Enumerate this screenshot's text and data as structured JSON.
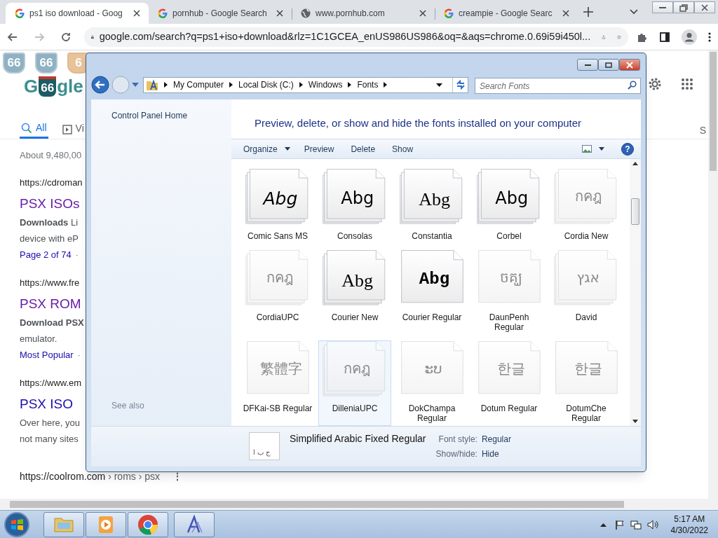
{
  "browser": {
    "tabs": [
      {
        "title": "ps1 iso download - Goog",
        "selected": true
      },
      {
        "title": "pornhub - Google Search",
        "selected": false
      },
      {
        "title": "www.pornhub.com",
        "selected": false
      },
      {
        "title": "creampie - Google Searc",
        "selected": false
      }
    ],
    "address": "google.com/search?q=ps1+iso+download&rlz=1C1GCEA_enUS986US986&oq=&aqs=chrome.0.69i59i450l..."
  },
  "google": {
    "badges": [
      "66",
      "66",
      "6"
    ],
    "logo": [
      "G",
      "66",
      "gle"
    ],
    "search_tabs": [
      {
        "label": "All",
        "selected": true
      },
      {
        "label": "Vi",
        "selected": false
      }
    ],
    "right_tab": "S",
    "result_count": "About 9,480,00",
    "results": [
      {
        "url": "https://cdroman",
        "title": "PSX ISOs",
        "visited": true,
        "snippet": [
          "**Downloads** Li",
          "device with eP"
        ],
        "link": "Page 2 of 74",
        "after": "·"
      },
      {
        "url": "https://www.fre",
        "title": "PSX ROM",
        "visited": true,
        "snippet": [
          "**Download PSX**",
          "emulator."
        ],
        "link": "Most Popular",
        "after": "·"
      },
      {
        "url": "https://www.em",
        "title": "PSX ISO",
        "visited": false,
        "snippet": [
          "Over here, you",
          "not many sites"
        ]
      }
    ],
    "last_url": [
      "https://coolrom.com",
      "› roms › psx"
    ],
    "more": "⋮"
  },
  "explorer": {
    "breadcrumbs": [
      "My Computer",
      "Local Disk (C:)",
      "Windows",
      "Fonts"
    ],
    "search_placeholder": "Search Fonts",
    "sidebar": {
      "top": "Control Panel Home",
      "bottom": "See also"
    },
    "heading": "Preview, delete, or show and hide the fonts installed on your computer",
    "toolbar": [
      {
        "label": "Organize",
        "menu": true
      },
      {
        "label": "Preview",
        "menu": false
      },
      {
        "label": "Delete",
        "menu": false
      },
      {
        "label": "Show",
        "menu": false
      }
    ],
    "help": "?",
    "fonts": [
      {
        "name": "Comic Sans MS",
        "sample": "Abg",
        "stacked": true,
        "hidden": false,
        "selected": false
      },
      {
        "name": "Consolas",
        "sample": "Abg",
        "stacked": true,
        "hidden": false,
        "selected": false
      },
      {
        "name": "Constantia",
        "sample": "Abg",
        "stacked": true,
        "hidden": false,
        "selected": false
      },
      {
        "name": "Corbel",
        "sample": "Abg",
        "stacked": true,
        "hidden": false,
        "selected": false
      },
      {
        "name": "Cordia New",
        "sample": "กคฎ",
        "stacked": true,
        "hidden": true,
        "selected": false
      },
      {
        "name": "CordiaUPC",
        "sample": "กคฎ",
        "stacked": true,
        "hidden": true,
        "selected": false
      },
      {
        "name": "Courier New",
        "sample": "Abg",
        "stacked": true,
        "hidden": false,
        "selected": false
      },
      {
        "name": "Courier Regular",
        "sample": "Abg",
        "stacked": false,
        "hidden": false,
        "selected": false
      },
      {
        "name": "DaunPenh Regular",
        "sample": "ចគ្ឃ",
        "stacked": false,
        "hidden": true,
        "selected": false
      },
      {
        "name": "David",
        "sample": "אגץ",
        "stacked": true,
        "hidden": true,
        "selected": false
      },
      {
        "name": "DFKai-SB Regular",
        "sample": "繁體字",
        "stacked": false,
        "hidden": true,
        "selected": false
      },
      {
        "name": "DilleniaUPC",
        "sample": "กคฎ",
        "stacked": true,
        "hidden": true,
        "selected": true
      },
      {
        "name": "DokChampa Regular",
        "sample": "ະບ",
        "stacked": false,
        "hidden": true,
        "selected": false
      },
      {
        "name": "Dotum Regular",
        "sample": "한글",
        "stacked": false,
        "hidden": true,
        "selected": false
      },
      {
        "name": "DotumChe Regular",
        "sample": "한글",
        "stacked": false,
        "hidden": true,
        "selected": false
      }
    ],
    "details": {
      "name": "Simplified Arabic Fixed Regular",
      "sample": "ج ب ا",
      "fields": [
        {
          "label": "Font style:",
          "value": "Regular"
        },
        {
          "label": "Show/hide:",
          "value": "Hide"
        }
      ]
    }
  },
  "taskbar": {
    "time": "5:17 AM",
    "date": "4/30/2022"
  }
}
